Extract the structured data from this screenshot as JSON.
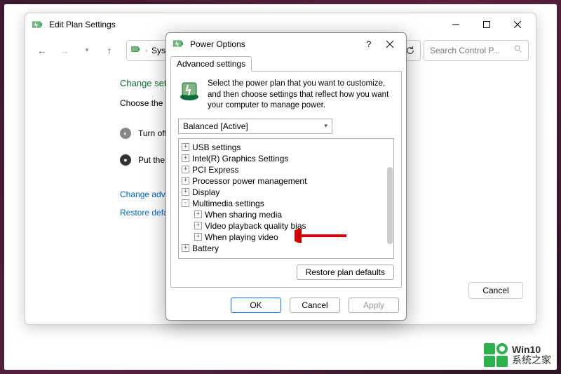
{
  "main_window": {
    "title": "Edit Plan Settings",
    "breadcrumb": "Syste",
    "search_placeholder": "Search Control P...",
    "heading": "Change setting",
    "description": "Choose the sleep a",
    "row1": "Turn off the di",
    "row2": "Put the compu",
    "link_advanced": "Change advanced",
    "link_restore": "Restore default set",
    "cancel": "Cancel"
  },
  "dialog": {
    "title": "Power Options",
    "tab": "Advanced settings",
    "intro": "Select the power plan that you want to customize, and then choose settings that reflect how you want your computer to manage power.",
    "plan": "Balanced [Active]",
    "tree": {
      "usb": "USB settings",
      "intel": "Intel(R) Graphics Settings",
      "pci": "PCI Express",
      "proc": "Processor power management",
      "display": "Display",
      "mm": "Multimedia settings",
      "mm_share": "When sharing media",
      "mm_quality": "Video playback quality bias",
      "mm_play": "When playing video",
      "battery": "Battery"
    },
    "restore_defaults": "Restore plan defaults",
    "ok": "OK",
    "cancel": "Cancel",
    "apply": "Apply"
  },
  "watermark": {
    "line1": "Win10",
    "line2": "系统之家"
  }
}
